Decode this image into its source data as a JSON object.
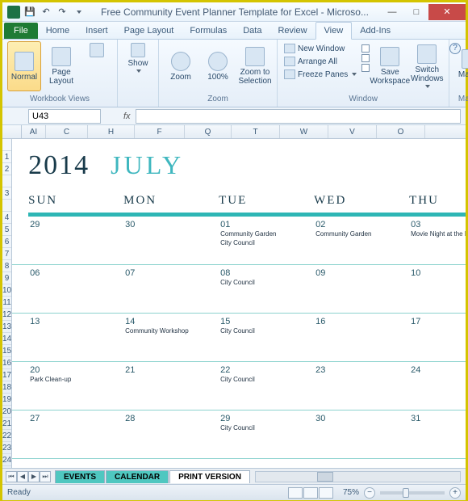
{
  "titlebar": {
    "title": "Free Community Event Planner Template for Excel - Microso..."
  },
  "tabs": {
    "file": "File",
    "items": [
      "Home",
      "Insert",
      "Page Layout",
      "Formulas",
      "Data",
      "Review",
      "View",
      "Add-Ins"
    ],
    "active": "View"
  },
  "ribbon": {
    "workbook_views": {
      "label": "Workbook Views",
      "normal": "Normal",
      "page_layout": "Page Layout"
    },
    "show": {
      "label": "Show",
      "btn": "Show"
    },
    "zoom": {
      "label": "Zoom",
      "zoom": "Zoom",
      "hundred": "100%",
      "zoom_to_selection": "Zoom to Selection"
    },
    "window": {
      "label": "Window",
      "new_window": "New Window",
      "arrange_all": "Arrange All",
      "freeze_panes": "Freeze Panes",
      "save_workspace": "Save Workspace",
      "switch_windows": "Switch Windows"
    },
    "macros": {
      "label": "Macros",
      "btn": "Macros"
    }
  },
  "namebox": {
    "value": "U43"
  },
  "fx_label": "fx",
  "colheaders": [
    "AI",
    "C",
    "H",
    "F",
    "Q",
    "T",
    "W",
    "V",
    "O"
  ],
  "rowheaders": [
    "",
    "1",
    "2",
    "",
    "3",
    "",
    "4",
    "5",
    "6",
    "7",
    "8",
    "9",
    "10",
    "11",
    "12",
    "13",
    "14",
    "15",
    "16",
    "17",
    "18",
    "19",
    "20",
    "21",
    "22",
    "23",
    "24",
    "25",
    "26"
  ],
  "calendar": {
    "year": "2014",
    "month": "JULY",
    "days": [
      "SUN",
      "MON",
      "TUE",
      "WED",
      "THU"
    ],
    "weeks": [
      [
        {
          "n": "29",
          "e": []
        },
        {
          "n": "30",
          "e": []
        },
        {
          "n": "01",
          "e": [
            "Community Garden",
            "City Council"
          ]
        },
        {
          "n": "02",
          "e": [
            "Community Garden"
          ]
        },
        {
          "n": "03",
          "e": [
            "Movie Night at the Par"
          ]
        }
      ],
      [
        {
          "n": "06",
          "e": []
        },
        {
          "n": "07",
          "e": []
        },
        {
          "n": "08",
          "e": [
            "City Council"
          ]
        },
        {
          "n": "09",
          "e": []
        },
        {
          "n": "10",
          "e": []
        }
      ],
      [
        {
          "n": "13",
          "e": []
        },
        {
          "n": "14",
          "e": [
            "Community Workshop"
          ]
        },
        {
          "n": "15",
          "e": [
            "City Council"
          ]
        },
        {
          "n": "16",
          "e": []
        },
        {
          "n": "17",
          "e": []
        }
      ],
      [
        {
          "n": "20",
          "e": [
            "Park Clean-up"
          ]
        },
        {
          "n": "21",
          "e": []
        },
        {
          "n": "22",
          "e": [
            "City Council"
          ]
        },
        {
          "n": "23",
          "e": []
        },
        {
          "n": "24",
          "e": []
        }
      ],
      [
        {
          "n": "27",
          "e": []
        },
        {
          "n": "28",
          "e": []
        },
        {
          "n": "29",
          "e": [
            "City Council"
          ]
        },
        {
          "n": "30",
          "e": []
        },
        {
          "n": "31",
          "e": []
        }
      ]
    ]
  },
  "sheets": {
    "events": "EVENTS",
    "calendar": "CALENDAR",
    "print": "PRINT VERSION"
  },
  "status": {
    "ready": "Ready",
    "zoom": "75%"
  }
}
